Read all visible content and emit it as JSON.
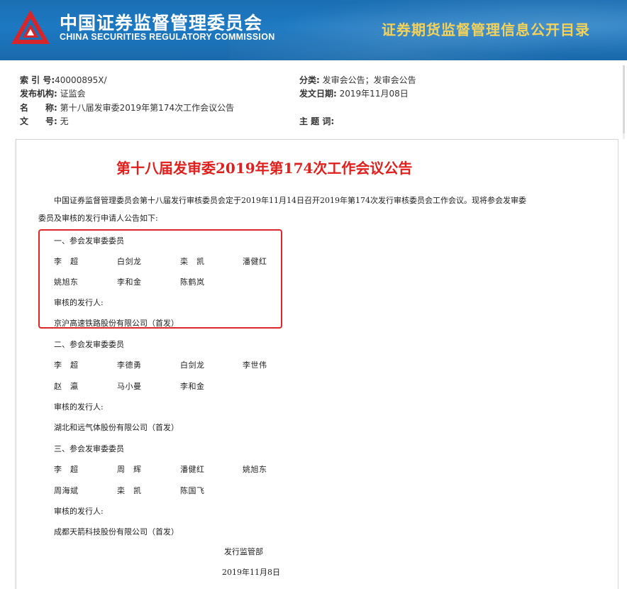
{
  "header": {
    "org_name_cn": "中国证券监督管理委员会",
    "org_name_en": "CHINA SECURITIES REGULATORY COMMISSION",
    "section_title": "证券期货监督管理信息公开目录",
    "logo_icon": "csrc-logo-icon",
    "banner_color": "#1b6fb3",
    "section_title_color": "#f4d25a"
  },
  "meta": {
    "index_key": "索 引 号:",
    "index_val": "40000895X/",
    "category_key": "分类:",
    "category_val": "发审会公告；发审会公告",
    "issuer_key": "发布机构:",
    "issuer_val": "证监会",
    "date_key": "发文日期:",
    "date_val": "2019年11月08日",
    "name_key": "名　　称:",
    "name_val": "第十八届发审委2019年第174次工作会议公告",
    "docno_key": "文　　号:",
    "docno_val": "无",
    "subject_key": "主 题 词:",
    "subject_val": ""
  },
  "document": {
    "title": "第十八届发审委2019年第174次工作会议公告",
    "title_color": "#e0201c",
    "intro_line1": "中国证券监督管理委员会第十八届发行审核委员会定于2019年11月14日召开2019年第174次发行审核委员会工作会议。现将参会发审委",
    "intro_line2": "委员及审核的发行申请人公告如下:",
    "sections": [
      {
        "heading": "一、参会发审委委员",
        "members_row1": [
          "李　超",
          "白剑龙",
          "栾　凯",
          "潘健红"
        ],
        "members_row2": [
          "姚旭东",
          "李和金",
          "陈鹤岚"
        ],
        "applicant_label": "审核的发行人:",
        "applicant": "京沪高速铁路股份有限公司（首发）"
      },
      {
        "heading": "二、参会发审委委员",
        "members_row1": [
          "李　超",
          "李德勇",
          "白剑龙",
          "李世伟"
        ],
        "members_row2": [
          "赵　瀛",
          "马小曼",
          "李和金"
        ],
        "applicant_label": "审核的发行人:",
        "applicant": "湖北和远气体股份有限公司（首发）"
      },
      {
        "heading": "三、参会发审委委员",
        "members_row1": [
          "李　超",
          "周　辉",
          "潘健红",
          "姚旭东"
        ],
        "members_row2": [
          "周海斌",
          "栾　凯",
          "陈国飞"
        ],
        "applicant_label": "审核的发行人:",
        "applicant": "成都天箭科技股份有限公司（首发）"
      }
    ],
    "signature": "发行监管部",
    "sign_date": "2019年11月8日",
    "highlight_color": "#e1262a"
  }
}
